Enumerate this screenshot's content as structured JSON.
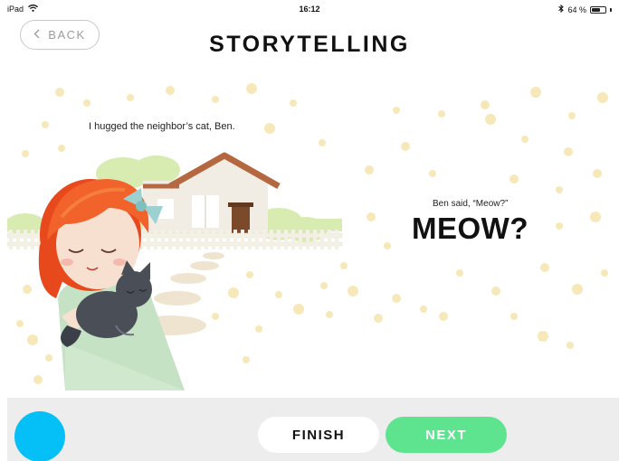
{
  "status_bar": {
    "device": "iPad",
    "wifi_icon": "wifi-icon",
    "time": "16:12",
    "bluetooth_icon": "bluetooth-icon",
    "battery_text": "64 %",
    "battery_level": 0.64
  },
  "header": {
    "back_label": "BACK",
    "back_icon": "chevron-left-icon",
    "title": "STORYTELLING"
  },
  "story": {
    "caption_left": "I hugged the neighbor’s cat, Ben.",
    "caption_right": "Ben said, “Meow?”",
    "big_text": "MEOW?"
  },
  "footer": {
    "finish_label": "FINISH",
    "next_label": "NEXT"
  },
  "colors": {
    "accent_blue": "#05c0f7",
    "next_green": "#5ee38f",
    "dot_yellow": "#f6e8b8",
    "roof_brown": "#b5683f",
    "hair_orange": "#f2622b"
  }
}
